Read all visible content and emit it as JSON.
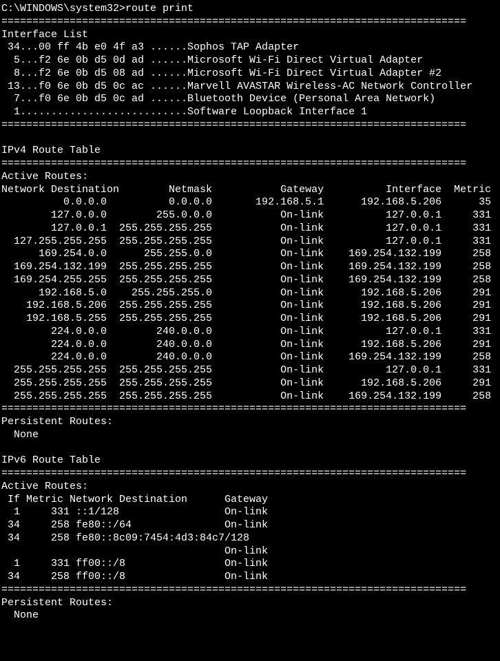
{
  "prompt_path": "C:\\WINDOWS\\system32>",
  "command": "route print",
  "divider": "===========================================================================",
  "interface_list_header": "Interface List",
  "interfaces": [
    {
      "id": "34",
      "mac": "00 ff 4b e0 4f a3",
      "name": "Sophos TAP Adapter"
    },
    {
      "id": "5",
      "mac": "f2 6e 0b d5 0d ad",
      "name": "Microsoft Wi-Fi Direct Virtual Adapter"
    },
    {
      "id": "8",
      "mac": "f2 6e 0b d5 08 ad",
      "name": "Microsoft Wi-Fi Direct Virtual Adapter #2"
    },
    {
      "id": "13",
      "mac": "f0 6e 0b d5 0c ac",
      "name": "Marvell AVASTAR Wireless-AC Network Controller"
    },
    {
      "id": "7",
      "mac": "f0 6e 0b d5 0c ad",
      "name": "Bluetooth Device (Personal Area Network)"
    },
    {
      "id": "1",
      "mac": "",
      "name": "Software Loopback Interface 1"
    }
  ],
  "ipv4_header": "IPv4 Route Table",
  "active_routes_label": "Active Routes:",
  "ipv4_columns": {
    "dest": "Network Destination",
    "mask": "Netmask",
    "gateway": "Gateway",
    "iface": "Interface",
    "metric": "Metric"
  },
  "ipv4_routes": [
    {
      "dest": "0.0.0.0",
      "mask": "0.0.0.0",
      "gateway": "192.168.5.1",
      "iface": "192.168.5.206",
      "metric": "35"
    },
    {
      "dest": "127.0.0.0",
      "mask": "255.0.0.0",
      "gateway": "On-link",
      "iface": "127.0.0.1",
      "metric": "331"
    },
    {
      "dest": "127.0.0.1",
      "mask": "255.255.255.255",
      "gateway": "On-link",
      "iface": "127.0.0.1",
      "metric": "331"
    },
    {
      "dest": "127.255.255.255",
      "mask": "255.255.255.255",
      "gateway": "On-link",
      "iface": "127.0.0.1",
      "metric": "331"
    },
    {
      "dest": "169.254.0.0",
      "mask": "255.255.0.0",
      "gateway": "On-link",
      "iface": "169.254.132.199",
      "metric": "258"
    },
    {
      "dest": "169.254.132.199",
      "mask": "255.255.255.255",
      "gateway": "On-link",
      "iface": "169.254.132.199",
      "metric": "258"
    },
    {
      "dest": "169.254.255.255",
      "mask": "255.255.255.255",
      "gateway": "On-link",
      "iface": "169.254.132.199",
      "metric": "258"
    },
    {
      "dest": "192.168.5.0",
      "mask": "255.255.255.0",
      "gateway": "On-link",
      "iface": "192.168.5.206",
      "metric": "291"
    },
    {
      "dest": "192.168.5.206",
      "mask": "255.255.255.255",
      "gateway": "On-link",
      "iface": "192.168.5.206",
      "metric": "291"
    },
    {
      "dest": "192.168.5.255",
      "mask": "255.255.255.255",
      "gateway": "On-link",
      "iface": "192.168.5.206",
      "metric": "291"
    },
    {
      "dest": "224.0.0.0",
      "mask": "240.0.0.0",
      "gateway": "On-link",
      "iface": "127.0.0.1",
      "metric": "331"
    },
    {
      "dest": "224.0.0.0",
      "mask": "240.0.0.0",
      "gateway": "On-link",
      "iface": "192.168.5.206",
      "metric": "291"
    },
    {
      "dest": "224.0.0.0",
      "mask": "240.0.0.0",
      "gateway": "On-link",
      "iface": "169.254.132.199",
      "metric": "258"
    },
    {
      "dest": "255.255.255.255",
      "mask": "255.255.255.255",
      "gateway": "On-link",
      "iface": "127.0.0.1",
      "metric": "331"
    },
    {
      "dest": "255.255.255.255",
      "mask": "255.255.255.255",
      "gateway": "On-link",
      "iface": "192.168.5.206",
      "metric": "291"
    },
    {
      "dest": "255.255.255.255",
      "mask": "255.255.255.255",
      "gateway": "On-link",
      "iface": "169.254.132.199",
      "metric": "258"
    }
  ],
  "persistent_routes_label": "Persistent Routes:",
  "persistent_none": "  None",
  "ipv6_header": "IPv6 Route Table",
  "ipv6_columns": {
    "if": "If",
    "metric": "Metric",
    "dest": "Network Destination",
    "gateway": "Gateway"
  },
  "ipv6_routes": [
    {
      "if": "1",
      "metric": "331",
      "dest": "::1/128",
      "gateway": "On-link"
    },
    {
      "if": "34",
      "metric": "258",
      "dest": "fe80::/64",
      "gateway": "On-link"
    },
    {
      "if": "34",
      "metric": "258",
      "dest": "fe80::8c09:7454:4d3:84c7/128",
      "gateway": "On-link",
      "wrap": true
    },
    {
      "if": "1",
      "metric": "331",
      "dest": "ff00::/8",
      "gateway": "On-link"
    },
    {
      "if": "34",
      "metric": "258",
      "dest": "ff00::/8",
      "gateway": "On-link"
    }
  ]
}
